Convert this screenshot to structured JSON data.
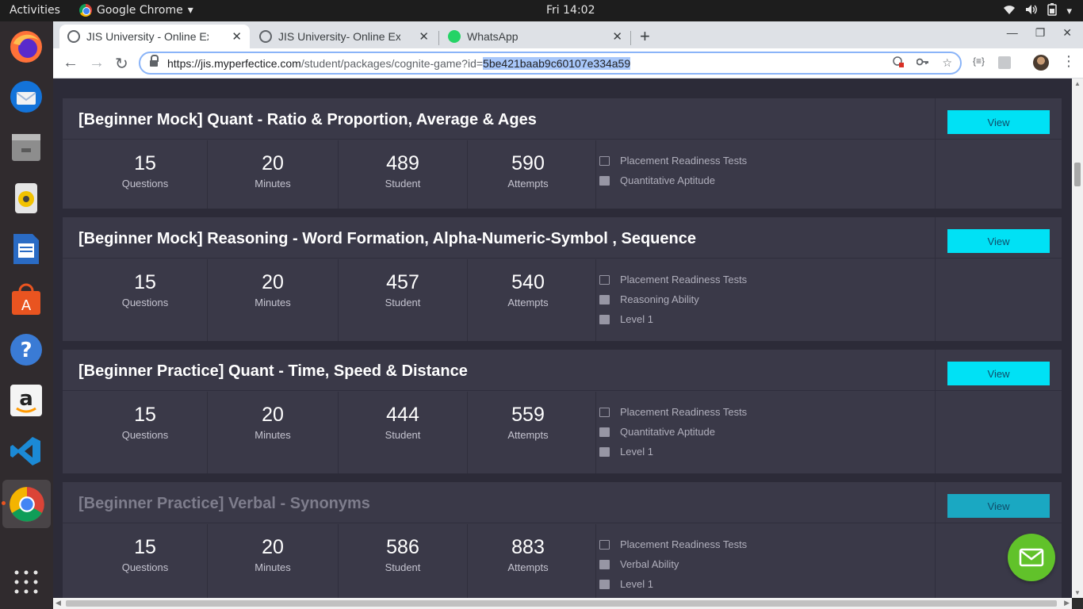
{
  "system_bar": {
    "activities": "Activities",
    "app_name": "Google Chrome",
    "clock": "Fri 14:02"
  },
  "dock": {
    "apps": [
      "firefox-icon",
      "thunderbird-icon",
      "files-icon",
      "rhythmbox-icon",
      "writer-icon",
      "software-center-icon",
      "help-icon",
      "amazon-icon",
      "vscode-icon",
      "chrome-icon",
      "app-grid-icon"
    ]
  },
  "browser": {
    "tabs": [
      {
        "title": "JIS University - Online Exa"
      },
      {
        "title": "JIS University- Online Exa"
      },
      {
        "title": "WhatsApp"
      }
    ],
    "url_host": "https://jis.myperfectice.com",
    "url_path": "/student/packages/cognite-game?id=",
    "url_selected": "5be421baab9c60107e334a59",
    "extension_label": "{≡}"
  },
  "cards": [
    {
      "title": "[Beginner Mock] Quant - Ratio & Proportion, Average & Ages",
      "view_label": "View",
      "stats": [
        {
          "value": "15",
          "label": "Questions"
        },
        {
          "value": "20",
          "label": "Minutes"
        },
        {
          "value": "489",
          "label": "Student"
        },
        {
          "value": "590",
          "label": "Attempts"
        }
      ],
      "tags": [
        "Placement Readiness Tests",
        "Quantitative Aptitude"
      ]
    },
    {
      "title": "[Beginner Mock] Reasoning - Word Formation, Alpha-Numeric-Symbol , Sequence",
      "view_label": "View",
      "stats": [
        {
          "value": "15",
          "label": "Questions"
        },
        {
          "value": "20",
          "label": "Minutes"
        },
        {
          "value": "457",
          "label": "Student"
        },
        {
          "value": "540",
          "label": "Attempts"
        }
      ],
      "tags": [
        "Placement Readiness Tests",
        "Reasoning Ability",
        "Level 1"
      ]
    },
    {
      "title": "[Beginner Practice] Quant - Time, Speed & Distance",
      "view_label": "View",
      "stats": [
        {
          "value": "15",
          "label": "Questions"
        },
        {
          "value": "20",
          "label": "Minutes"
        },
        {
          "value": "444",
          "label": "Student"
        },
        {
          "value": "559",
          "label": "Attempts"
        }
      ],
      "tags": [
        "Placement Readiness Tests",
        "Quantitative Aptitude",
        "Level 1"
      ]
    },
    {
      "title": "[Beginner Practice] Verbal - Synonyms",
      "view_label": "View",
      "stats": [
        {
          "value": "15",
          "label": "Questions"
        },
        {
          "value": "20",
          "label": "Minutes"
        },
        {
          "value": "586",
          "label": "Student"
        },
        {
          "value": "883",
          "label": "Attempts"
        }
      ],
      "tags": [
        "Placement Readiness Tests",
        "Verbal Ability",
        "Level 1"
      ]
    }
  ],
  "colors": {
    "page_bg": "#2c2b38",
    "card_bg": "#3a3948",
    "view_button": "#00e1f5",
    "fab": "#61c22a"
  }
}
